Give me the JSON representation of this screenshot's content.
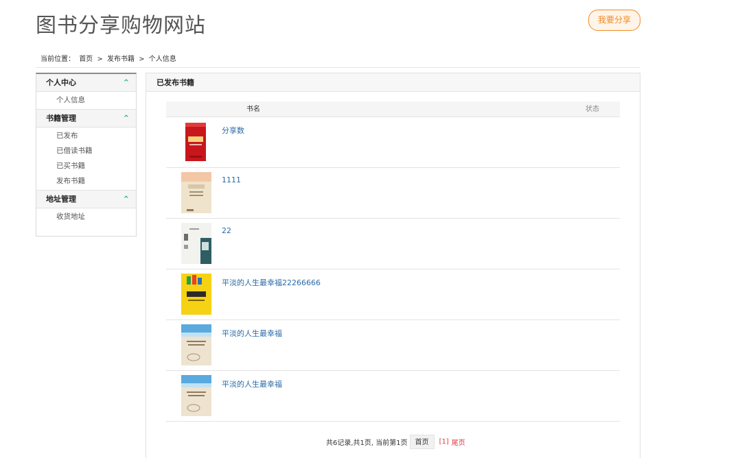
{
  "header": {
    "site_title": "图书分享购物网站",
    "share_button": "我要分享"
  },
  "breadcrumb": {
    "label": "当前位置：",
    "items": [
      "首页",
      "发布书籍",
      "个人信息"
    ],
    "sep": ">"
  },
  "sidebar": {
    "groups": [
      {
        "title": "个人中心",
        "items": [
          "个人信息"
        ]
      },
      {
        "title": "书籍管理",
        "items": [
          "已发布",
          "已借读书籍",
          "已买书籍",
          "发布书籍"
        ]
      },
      {
        "title": "地址管理",
        "items": [
          "收货地址"
        ]
      }
    ],
    "chevron": "^"
  },
  "panel": {
    "title": "已发布书籍",
    "columns": {
      "name": "书名",
      "status": "状态"
    },
    "books": [
      {
        "title": "分享数",
        "cover": "red-book-cover"
      },
      {
        "title": "1111",
        "cover": "beige-book-cover"
      },
      {
        "title": "22",
        "cover": "white-grey-book-cover"
      },
      {
        "title": "平淡的人生最幸福22266666",
        "cover": "yellow-book-cover"
      },
      {
        "title": "平淡的人生最幸福",
        "cover": "sky-sand-book-cover"
      },
      {
        "title": "平淡的人生最幸福",
        "cover": "sky-sand-book-cover"
      }
    ]
  },
  "pager": {
    "summary": "共6记录,共1页, 当前第1页",
    "first": "首页",
    "current": "[1]",
    "last": "尾页"
  },
  "colors": {
    "accent": "#f08a24",
    "link": "#2a6aa8",
    "chevron": "#1aa89a",
    "pager_red": "#e0393e"
  }
}
